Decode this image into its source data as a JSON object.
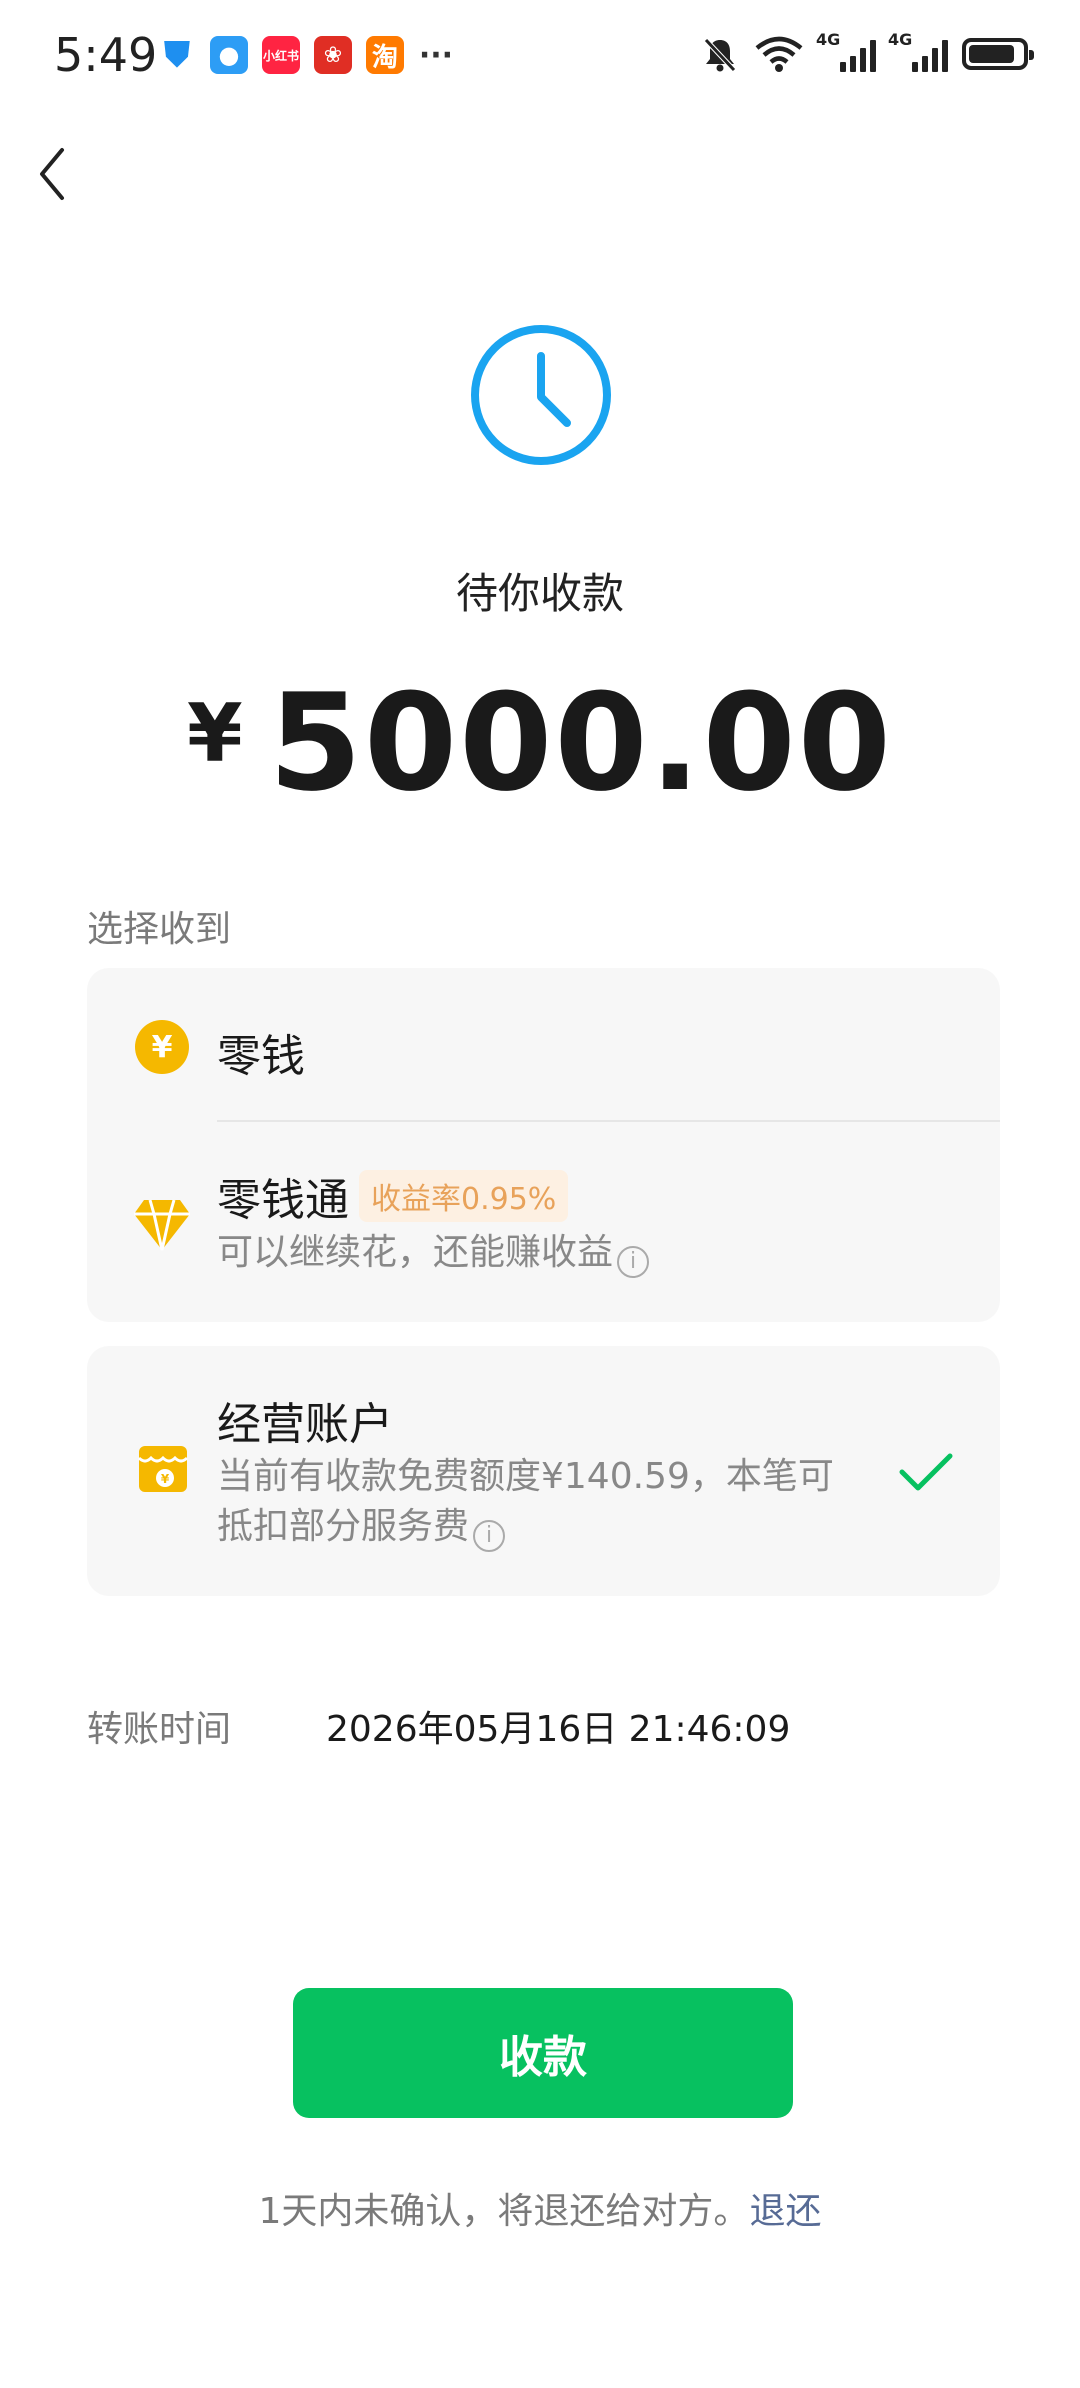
{
  "status_bar": {
    "time": "5:49",
    "notifications": [
      "shield-icon",
      "chat-icon",
      "xiaohongshu-icon",
      "pinduoduo-icon",
      "taobao-icon"
    ],
    "xhs_label": "小红书",
    "tb_label": "淘",
    "more": "···",
    "net1": "4G",
    "net2": "4G",
    "battery_level": 0.78
  },
  "header": {
    "title": "待你收款",
    "currency": "¥",
    "amount": "5000.00"
  },
  "receive": {
    "section_label": "选择收到",
    "change": {
      "coin_symbol": "¥",
      "title": "零钱"
    },
    "change_plus": {
      "title": "零钱通",
      "badge": "收益率0.95%",
      "subtitle": "可以继续花，还能赚收益"
    },
    "business": {
      "title": "经营账户",
      "line1": "当前有收款免费额度¥140.59，本笔可",
      "line2": "抵扣部分服务费",
      "selected": true
    },
    "info_symbol": "i"
  },
  "transfer": {
    "label": "转账时间",
    "value": "2026年05月16日 21:46:09"
  },
  "actions": {
    "accept": "收款",
    "note": "1天内未确认，将退还给对方。",
    "refund_link": "退还"
  },
  "colors": {
    "primary_green": "#07c160",
    "clock_blue": "#1aa4f0",
    "coin_yellow": "#f5b800",
    "link_blue": "#576b95"
  }
}
